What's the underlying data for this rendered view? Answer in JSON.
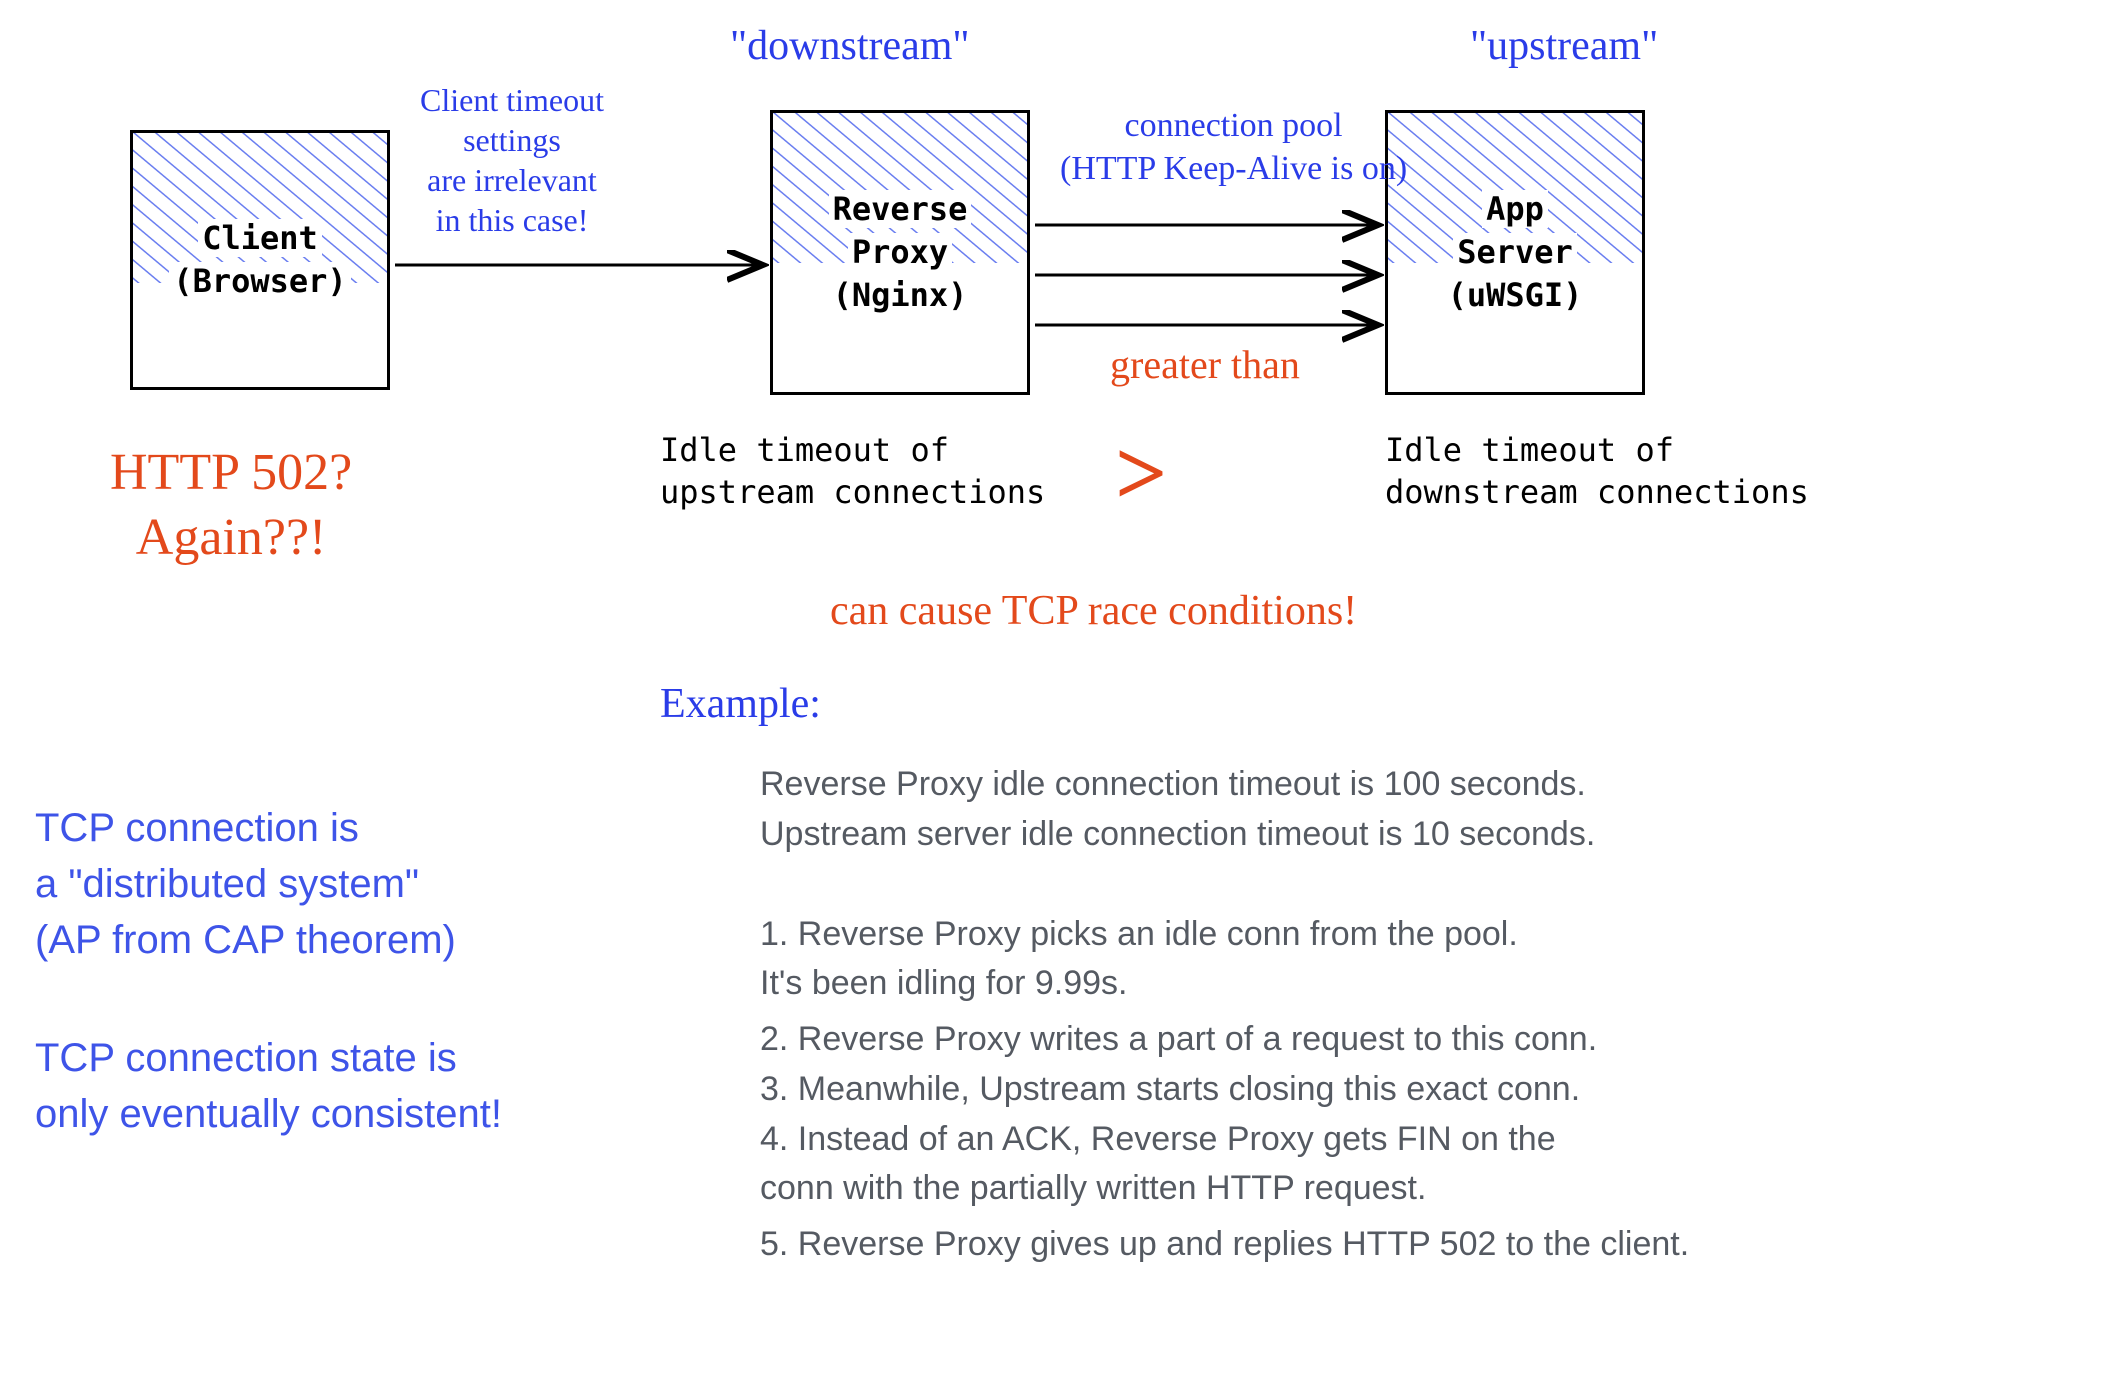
{
  "colors": {
    "blue": "#2a3ce8",
    "orange": "#e3491b",
    "boxFill": "#8ea0f5",
    "textGray": "#555a62"
  },
  "boxes": {
    "client": {
      "line1": "Client",
      "line2": "(Browser)"
    },
    "proxy": {
      "line1": "Reverse",
      "line2": "Proxy",
      "line3": "(Nginx)"
    },
    "app": {
      "line1": "App",
      "line2": "Server",
      "line3": "(uWSGI)"
    }
  },
  "labels": {
    "downstream": "\"downstream\"",
    "upstream": "\"upstream\"",
    "clientTimeoutNote": "Client timeout\nsettings\nare irrelevant\nin this case!",
    "connectionPool": "connection pool\n(HTTP Keep-Alive is on)",
    "greaterThan": "greater than",
    "idleTimeoutUpstream": "Idle timeout of\nupstream connections",
    "idleTimeoutDownstream": "Idle timeout of\ndownstream connections",
    "raceCondition": "can cause TCP race conditions!",
    "http502": "HTTP 502?\nAgain??!",
    "gtSymbol": ">"
  },
  "example": {
    "header": "Example:",
    "intro1": "Reverse Proxy idle connection timeout is 100 seconds.",
    "intro2": "Upstream server idle connection timeout is 10 seconds.",
    "steps": [
      "1. Reverse Proxy picks an idle conn from the pool.\n    It's been idling for 9.99s.",
      "2. Reverse Proxy writes a part of a request to this conn.",
      "3. Meanwhile, Upstream starts closing this exact conn.",
      "4. Instead of an ACK, Reverse Proxy gets FIN on the\n    conn with the partially written HTTP request.",
      "5. Reverse Proxy gives up and replies HTTP 502 to the client."
    ]
  },
  "sideNotes": {
    "note1": "TCP connection is\na \"distributed system\"\n(AP from CAP theorem)",
    "note2": "TCP connection state is\nonly eventually consistent!"
  }
}
